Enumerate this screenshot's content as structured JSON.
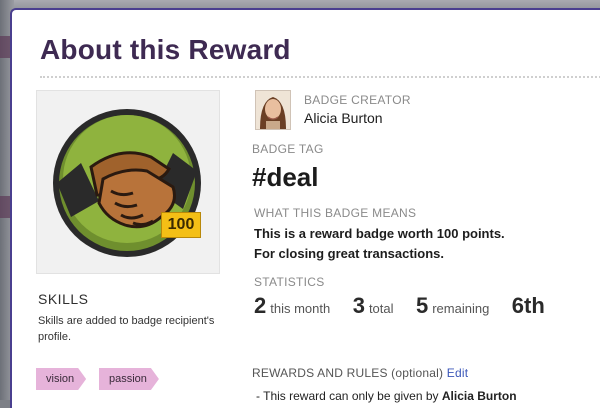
{
  "modal": {
    "title": "About this Reward",
    "badge": {
      "icon": "handshake-icon",
      "points": "100"
    },
    "skills": {
      "title": "SKILLS",
      "description": "Skills are added to badge recipient's profile.",
      "tags": [
        "vision",
        "passion"
      ]
    },
    "creator": {
      "label": "BADGE CREATOR",
      "name": "Alicia Burton"
    },
    "badge_tag": {
      "label": "BADGE TAG",
      "value": "#deal"
    },
    "meaning": {
      "label": "WHAT THIS BADGE MEANS",
      "line1": "This is a reward badge worth 100 points.",
      "line2": "For closing great transactions."
    },
    "statistics": {
      "label": "STATISTICS",
      "month_value": "2",
      "month_unit": "this month",
      "total_value": "3",
      "total_unit": "total",
      "remaining_value": "5",
      "remaining_unit": "remaining",
      "rank": "6th"
    },
    "rules": {
      "label": "REWARDS AND RULES (optional)",
      "edit_link": "Edit",
      "line_prefix": "- This reward can only be given by",
      "line_name": "Alicia Burton"
    }
  },
  "colors": {
    "title": "#3e2a52",
    "border": "#4a3f8f",
    "tag": "#e6b3da",
    "points_tag": "#f4bf16",
    "link": "#3a56b8"
  }
}
